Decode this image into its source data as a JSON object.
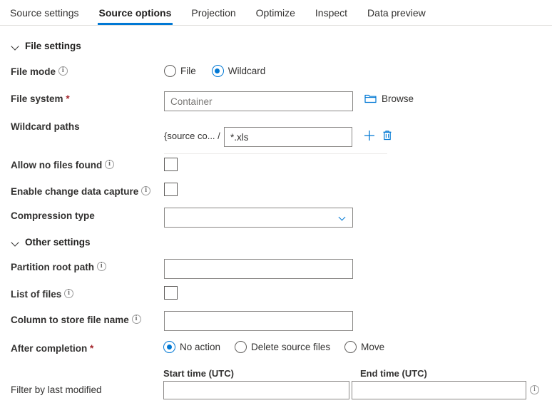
{
  "tabs": [
    {
      "label": "Source settings",
      "active": false
    },
    {
      "label": "Source options",
      "active": true
    },
    {
      "label": "Projection",
      "active": false
    },
    {
      "label": "Optimize",
      "active": false
    },
    {
      "label": "Inspect",
      "active": false
    },
    {
      "label": "Data preview",
      "active": false
    }
  ],
  "sections": {
    "file_settings": {
      "title": "File settings"
    },
    "other_settings": {
      "title": "Other settings"
    }
  },
  "file_mode": {
    "label": "File mode",
    "options": [
      {
        "label": "File",
        "checked": false
      },
      {
        "label": "Wildcard",
        "checked": true
      }
    ]
  },
  "file_system": {
    "label": "File system",
    "required_marker": "*",
    "placeholder": "Container",
    "value": "",
    "browse_label": "Browse"
  },
  "wildcard_paths": {
    "label": "Wildcard paths",
    "prefix": "{source co...  /",
    "value": "*.xls",
    "add_label": "+",
    "delete_label": "delete"
  },
  "allow_no_files_found": {
    "label": "Allow no files found",
    "checked": false
  },
  "enable_cdc": {
    "label": "Enable change data capture",
    "checked": false
  },
  "compression_type": {
    "label": "Compression type",
    "value": ""
  },
  "partition_root_path": {
    "label": "Partition root path",
    "value": ""
  },
  "list_of_files": {
    "label": "List of files",
    "checked": false
  },
  "column_to_store_file_name": {
    "label": "Column to store file name",
    "value": ""
  },
  "after_completion": {
    "label": "After completion",
    "required_marker": "*",
    "options": [
      {
        "label": "No action",
        "checked": true
      },
      {
        "label": "Delete source files",
        "checked": false
      },
      {
        "label": "Move",
        "checked": false
      }
    ]
  },
  "filter_by_last_modified": {
    "label": "Filter by last modified",
    "start_time_header": "Start time (UTC)",
    "end_time_header": "End time (UTC)",
    "start_time_value": "",
    "end_time_value": ""
  },
  "colors": {
    "accent": "#0078d4",
    "text": "#323130",
    "border": "#8a8886",
    "required": "#a4262c",
    "divider": "#e1dfdd"
  }
}
